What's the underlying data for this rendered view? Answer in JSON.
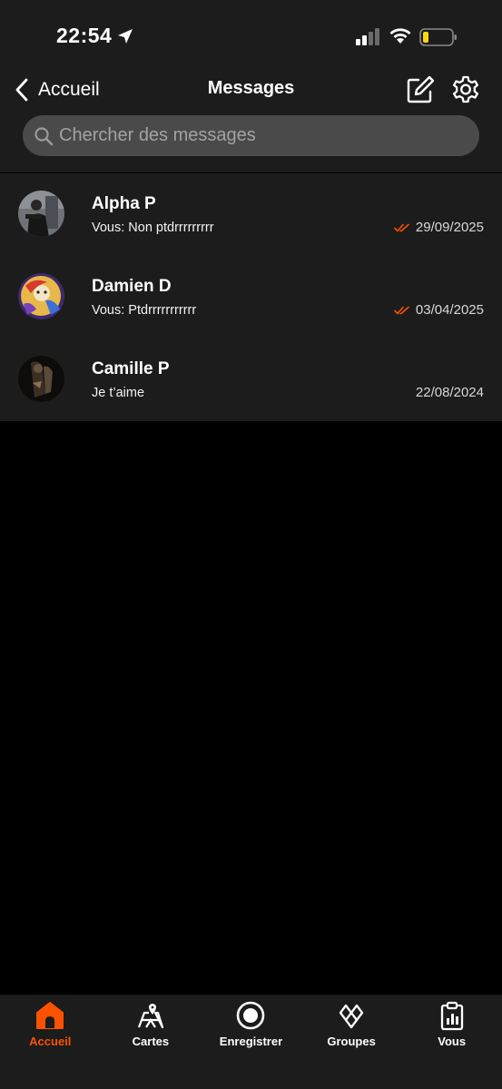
{
  "status_bar": {
    "time": "22:54",
    "battery_color": "#f5d90a"
  },
  "header": {
    "back_label": "Accueil",
    "title": "Messages"
  },
  "search": {
    "placeholder": "Chercher des messages"
  },
  "conversations": [
    {
      "name": "Alpha P",
      "preview": "Vous: Non ptdrrrrrrrrr",
      "date": "29/09/2025",
      "read_receipt": true
    },
    {
      "name": "Damien D",
      "preview": "Vous: Ptdrrrrrrrrrrr",
      "date": "03/04/2025",
      "read_receipt": true
    },
    {
      "name": "Camille P",
      "preview": "Je t’aime",
      "date": "22/08/2024",
      "read_receipt": false
    }
  ],
  "tabs": [
    {
      "label": "Accueil",
      "icon": "home-icon",
      "active": true
    },
    {
      "label": "Cartes",
      "icon": "map-icon",
      "active": false
    },
    {
      "label": "Enregistrer",
      "icon": "record-icon",
      "active": false
    },
    {
      "label": "Groupes",
      "icon": "groups-icon",
      "active": false
    },
    {
      "label": "Vous",
      "icon": "clipboard-chart-icon",
      "active": false
    }
  ],
  "colors": {
    "accent": "#fc5200",
    "background": "#000000",
    "surface": "#1c1c1c",
    "search_field": "#4a4a4a"
  }
}
